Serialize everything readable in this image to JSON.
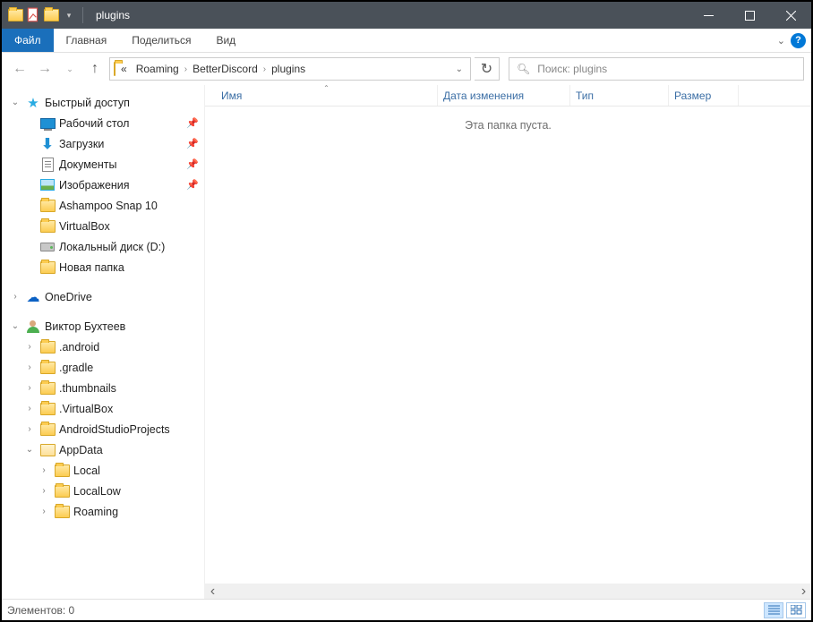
{
  "window": {
    "title": "plugins"
  },
  "tabs": {
    "file": "Файл",
    "home": "Главная",
    "share": "Поделиться",
    "view": "Вид"
  },
  "breadcrumb": {
    "prefix": "«",
    "items": [
      "Roaming",
      "BetterDiscord",
      "plugins"
    ]
  },
  "search": {
    "placeholder": "Поиск: plugins"
  },
  "columns": {
    "name": "Имя",
    "date": "Дата изменения",
    "type": "Тип",
    "size": "Размер"
  },
  "content": {
    "empty": "Эта папка пуста."
  },
  "status": {
    "items": "Элементов: 0"
  },
  "tree": {
    "quick_access": {
      "label": "Быстрый доступ",
      "items": [
        {
          "label": "Рабочий стол",
          "pinned": true,
          "icon": "desktop"
        },
        {
          "label": "Загрузки",
          "pinned": true,
          "icon": "downloads"
        },
        {
          "label": "Документы",
          "pinned": true,
          "icon": "documents"
        },
        {
          "label": "Изображения",
          "pinned": true,
          "icon": "pictures"
        },
        {
          "label": "Ashampoo Snap 10",
          "pinned": false,
          "icon": "folder"
        },
        {
          "label": "VirtualBox",
          "pinned": false,
          "icon": "folder"
        },
        {
          "label": "Локальный диск (D:)",
          "pinned": false,
          "icon": "disk"
        },
        {
          "label": "Новая папка",
          "pinned": false,
          "icon": "folder"
        }
      ]
    },
    "onedrive": {
      "label": "OneDrive"
    },
    "user": {
      "label": "Виктор Бухтеев",
      "items": [
        {
          "label": ".android"
        },
        {
          "label": ".gradle"
        },
        {
          "label": ".thumbnails"
        },
        {
          "label": ".VirtualBox"
        },
        {
          "label": "AndroidStudioProjects"
        },
        {
          "label": "AppData",
          "expanded": true,
          "children": [
            {
              "label": "Local"
            },
            {
              "label": "LocalLow"
            },
            {
              "label": "Roaming"
            }
          ]
        }
      ]
    }
  }
}
